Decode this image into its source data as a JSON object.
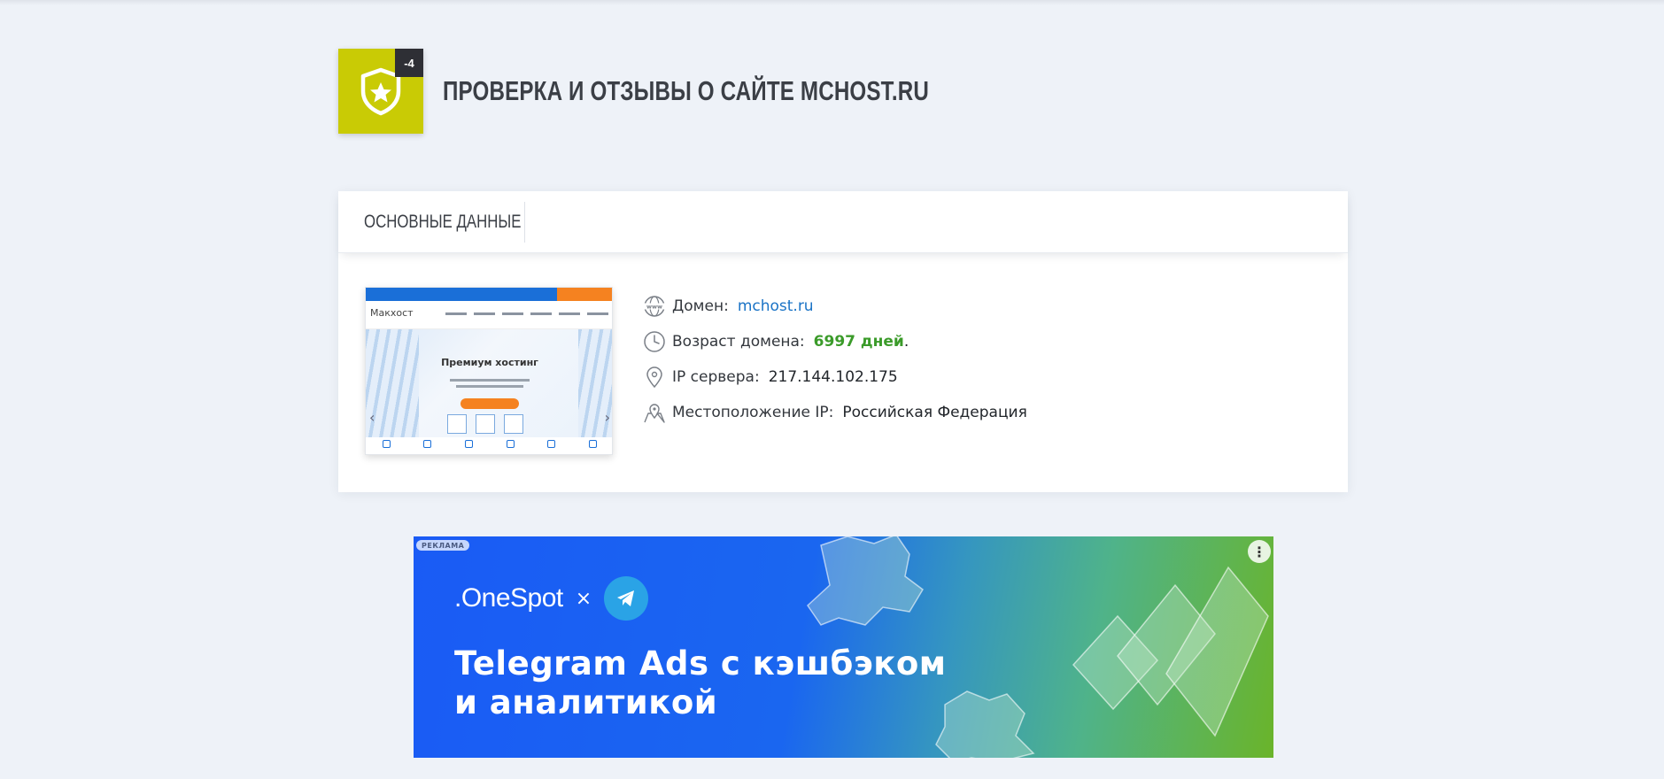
{
  "header": {
    "score": "-4",
    "title": "ПРОВЕРКА И ОТЗЫВЫ О САЙТЕ MCHOST.RU"
  },
  "card": {
    "tab_label": "ОСНОВНЫЕ ДАННЫЕ",
    "thumbnail": {
      "logo": "Макхост",
      "hero_title": "Премиум хостинг"
    },
    "info": {
      "domain_label": "Домен:",
      "domain_value": "mchost.ru",
      "age_label": "Возраст домена:",
      "age_value": "6997 дней",
      "age_suffix": ".",
      "ip_label": "IP сервера:",
      "ip_value": "217.144.102.175",
      "location_label": "Местоположение IP:",
      "location_value": "Российская Федерация"
    }
  },
  "ad": {
    "tag": "РЕКЛАМА",
    "brand": ".OneSpot",
    "times": "×",
    "headline_line1": "Telegram Ads с кэшбэком",
    "headline_line2": "и аналитикой",
    "menu_glyph": "⋮"
  },
  "colors": {
    "background": "#eef2f8",
    "badge": "#c9cb05",
    "link": "#1a73c6",
    "age_green": "#3b9b2a",
    "ad_blue": "#1a5bf5",
    "ad_green": "#6ab42a"
  },
  "icons": [
    "shield-star-icon",
    "www-globe-icon",
    "clock-icon",
    "location-pin-icon",
    "map-pin-icon",
    "telegram-icon",
    "kebab-menu-icon"
  ]
}
